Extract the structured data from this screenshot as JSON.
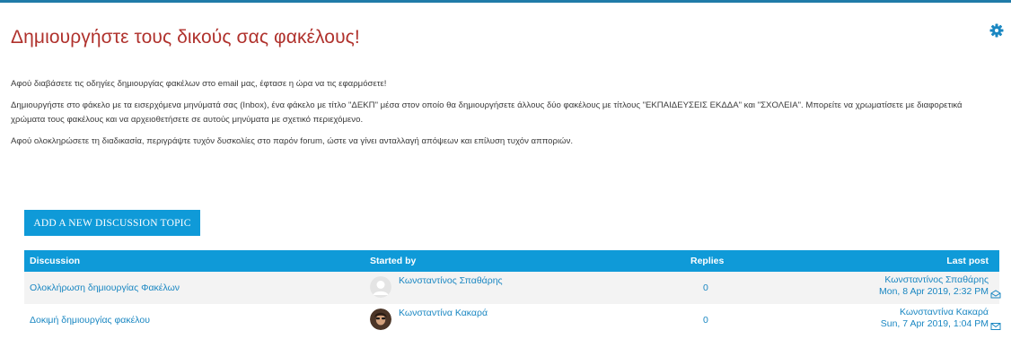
{
  "page": {
    "title": "Δημιουργήστε τους δικούς σας φακέλους!",
    "intro": [
      "Αφού διαβάσετε τις οδηγίες δημιουργίας φακέλων στο email μας, έφτασε η ώρα να τις εφαρμόσετε!",
      "Δημιουργήστε στο φάκελο με τα εισερχόμενα  μηνύματά σας (Inbox), ένα φάκελο με τίτλο \"ΔΕΚΠ\" μέσα στον οποίο θα δημιουργήσετε άλλους δύο φακέλους με τίτλους \"ΕΚΠΑΙΔΕΥΣΕΙΣ ΕΚΔΔΑ\" και \"ΣΧΟΛΕΙΑ\". Μπορείτε να χρωματίσετε με διαφορετικά χρώματα τους φακέλους και να αρχειοθετήσετε σε αυτούς μηνύματα με σχετικό περιεχόμενο.",
      "Αφού ολοκληρώσετε τη διαδικασία, περιγράψτε τυχόν δυσκολίες στο παρόν forum, ώστε να γίνει ανταλλαγή απόψεων και επίλυση τυχόν απποριών."
    ],
    "settings_icon": "gear-icon"
  },
  "actions": {
    "add_topic_label": "ADD A NEW DISCUSSION TOPIC"
  },
  "table": {
    "headers": {
      "discussion": "Discussion",
      "started_by": "Started by",
      "replies": "Replies",
      "last_post": "Last post"
    },
    "rows": [
      {
        "discussion": "Ολοκλήρωση δημιουργίας Φακέλων",
        "started_by": "Κωνσταντίνος Σπαθάρης",
        "avatar": "default-avatar",
        "replies": "0",
        "last_post_author": "Κωνσταντίνος Σπαθάρης",
        "last_post_date": "Mon, 8 Apr 2019, 2:32 PM",
        "mail_icon": "mail-open-icon"
      },
      {
        "discussion": "Δοκιμή δημιουργίας φακέλου",
        "started_by": "Κωνσταντίνα Κακαρά",
        "avatar": "user-photo-avatar",
        "replies": "0",
        "last_post_author": "Κωνσταντίνα Κακαρά",
        "last_post_date": "Sun, 7 Apr 2019, 1:04 PM",
        "mail_icon": "mail-closed-icon"
      }
    ]
  },
  "colors": {
    "title": "#b0322d",
    "accent": "#0f9ad8",
    "link": "#1a87c2",
    "topbar": "#1f7ba8"
  }
}
